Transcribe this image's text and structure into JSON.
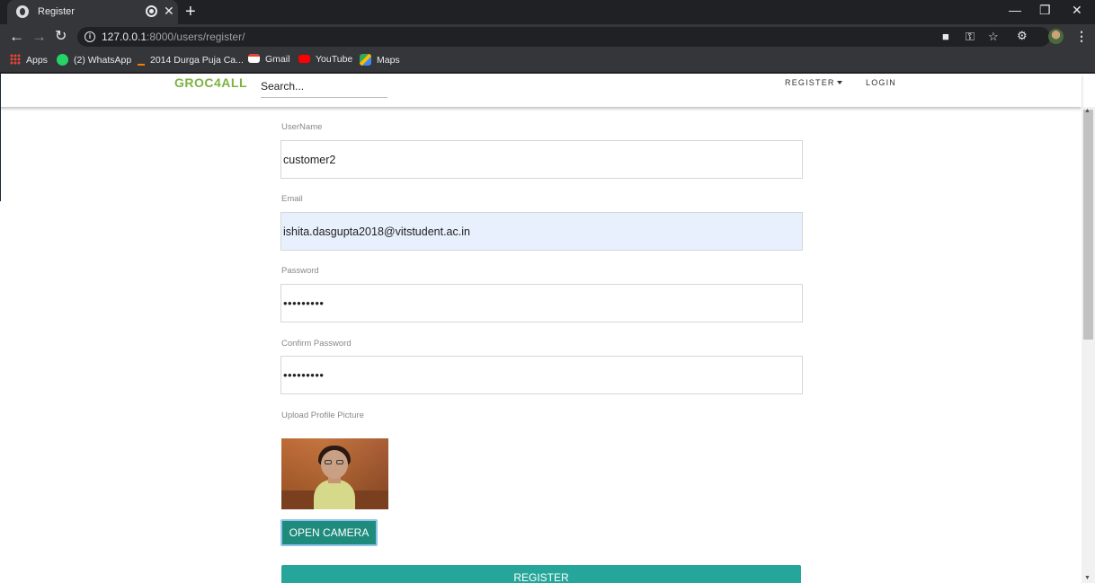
{
  "browser": {
    "tab_title": "Register",
    "tab_close": "✕",
    "new_tab": "+",
    "window_controls": {
      "minimize": "—",
      "restore": "❐",
      "close": "✕"
    },
    "url_host": "127.0.0.1",
    "url_rest": ":8000/users/register/",
    "bookmarks": [
      {
        "label": "Apps",
        "icon": "apps-grid-icon"
      },
      {
        "label": "(2) WhatsApp",
        "icon": "whatsapp-icon",
        "color": "#25d366"
      },
      {
        "label": "2014 Durga Puja Ca...",
        "icon": "durga-puja-icon",
        "color": "#f57c00"
      },
      {
        "label": "Gmail",
        "icon": "gmail-icon",
        "color": "#ea4335"
      },
      {
        "label": "YouTube",
        "icon": "youtube-icon",
        "color": "#ff0000"
      },
      {
        "label": "Maps",
        "icon": "maps-icon",
        "color": "#34a853"
      }
    ]
  },
  "navbar": {
    "brand": "GROC4ALL",
    "brand_color": "#7cb342",
    "search_placeholder": "Search...",
    "links": {
      "register": "REGISTER",
      "login": "LOGIN"
    }
  },
  "form": {
    "username_label": "UserName",
    "username_value": "customer2",
    "email_label": "Email",
    "email_value": "ishita.dasgupta2018@vitstudent.ac.in",
    "password_label": "Password",
    "password_value": "•••••••••",
    "confirm_label": "Confirm Password",
    "confirm_value": "•••••••••",
    "upload_label": "Upload Profile Picture",
    "open_camera": "OPEN CAMERA",
    "register_button": "REGISTER",
    "accent_color": "#26a69a"
  }
}
